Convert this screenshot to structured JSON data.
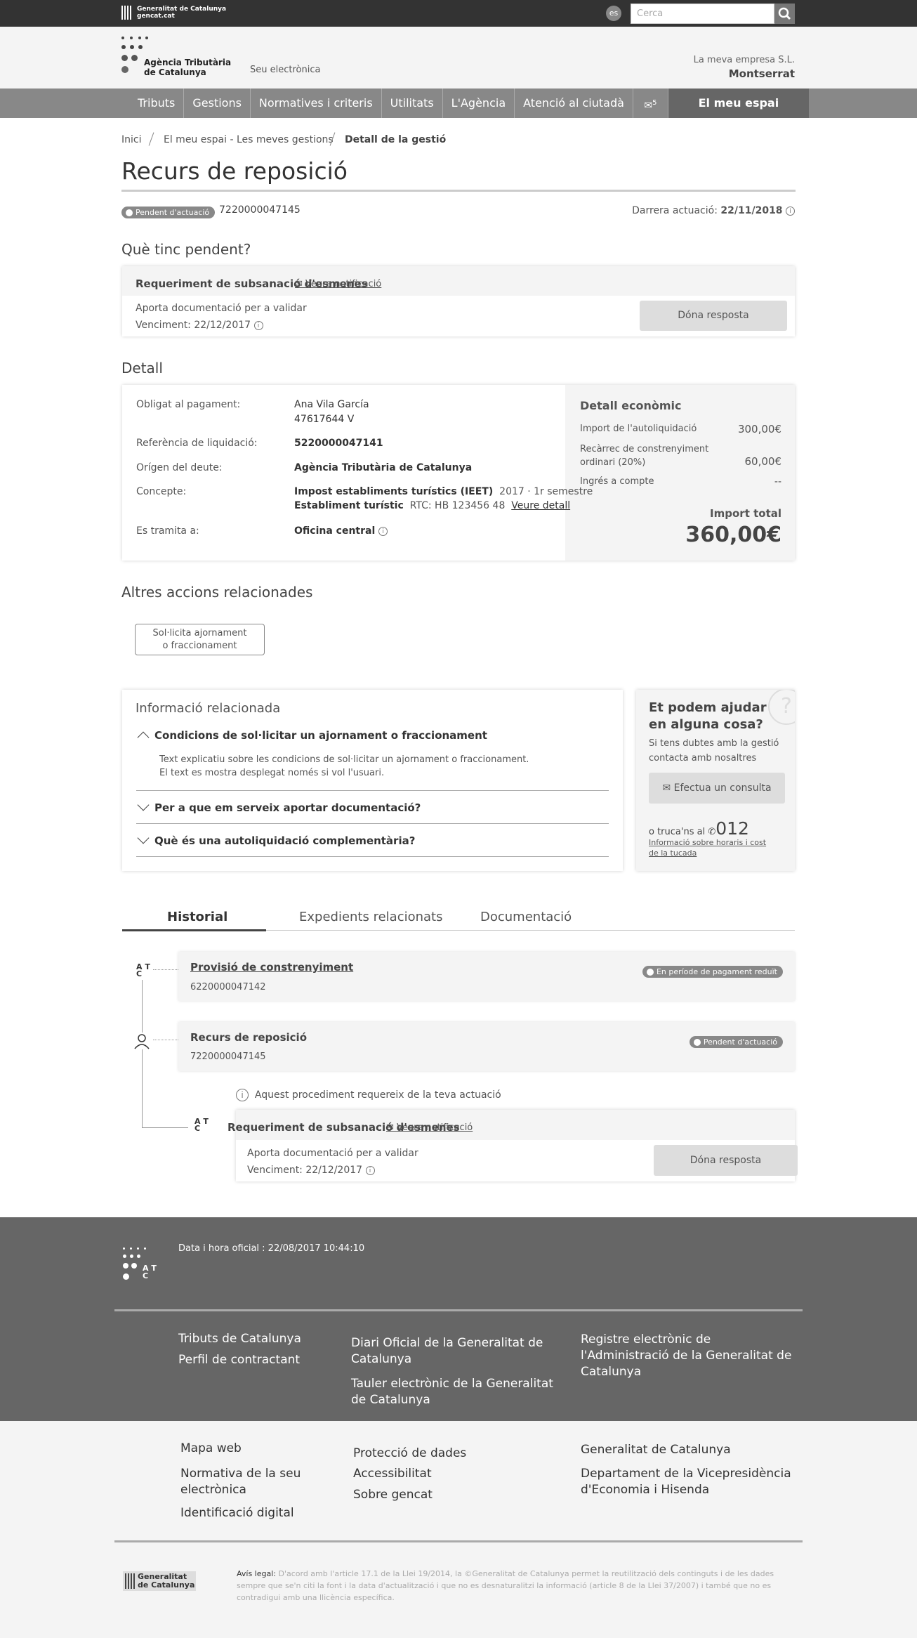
{
  "topbar": {
    "gencat_line1": "Generalitat de Catalunya",
    "gencat_line2": "gencat.cat",
    "lang": "es",
    "search_placeholder": "Cerca"
  },
  "header": {
    "agency_line1": "Agència Tributària",
    "agency_line2": "de Catalunya",
    "seu": "Seu electrònica",
    "company": "La meva empresa S.L.",
    "user": "Montserrat"
  },
  "nav": {
    "items": [
      "Tributs",
      "Gestions",
      "Normatives i criteris",
      "Utilitats",
      "L'Agència",
      "Atenció al ciutadà"
    ],
    "mail_count": "5",
    "espai": "El meu espai"
  },
  "breadcrumb": [
    "Inici",
    "El meu espai - Les meves gestions",
    "Detall de la gestió"
  ],
  "page": {
    "title": "Recurs de reposició",
    "status": "Pendent d'actuació",
    "ref": "7220000047145",
    "last_label": "Darrera actuació:",
    "last_date": "22/11/2018"
  },
  "pending": {
    "heading": "Què tinc pendent?",
    "card_title": "Requeriment de subsanació d'esmenes",
    "notif": "Veure notificació",
    "desc": "Aporta documentació per a validar",
    "due": "Venciment: 22/12/2017",
    "button": "Dóna resposta"
  },
  "detail": {
    "heading": "Detall",
    "rows": [
      {
        "label": "Obligat al pagament:",
        "value": "Ana Vila García",
        "value2": "47617644 V"
      },
      {
        "label": "Referència de liquidació:",
        "value": "5220000047141"
      },
      {
        "label": "Orígen del deute:",
        "value": "Agència Tributària de Catalunya"
      },
      {
        "label": "Concepte:",
        "value": "Impost establiments turístics (IEET)",
        "extra": "2017 · 1r semestre",
        "value2": "Establiment turístic",
        "extra2": "RTC: HB 123456 48",
        "link": "Veure detall"
      },
      {
        "label": "Es tramita a:",
        "value": "Oficina central"
      }
    ],
    "econ_title": "Detall econòmic",
    "econ": [
      {
        "label": "Import de l'autoliquidació",
        "value": "300,00€"
      },
      {
        "label": "Recàrrec de constrenyiment ordinari (20%)",
        "value": "60,00€"
      },
      {
        "label": "Ingrés a compte",
        "value": "--"
      }
    ],
    "total_label": "Import total",
    "total": "360,00€"
  },
  "actions": {
    "heading": "Altres accions relacionades",
    "button_l1": "Sol·licita ajornament",
    "button_l2": "o fraccionament"
  },
  "related": {
    "heading": "Informació relacionada",
    "acc": [
      {
        "title": "Condicions de sol·licitar un ajornament o fraccionament",
        "text1": "Text explicatiu sobre les condicions de sol·licitar un ajornament o fraccionament.",
        "text2": "El text es mostra desplegat només si vol l'usuari."
      },
      {
        "title": "Per a que em serveix aportar documentació?"
      },
      {
        "title": "Què és una autoliquidació complementària?"
      }
    ]
  },
  "help": {
    "title_l1": "Et podem ajudar",
    "title_l2": "en alguna cosa?",
    "text_l1": "Si tens dubtes amb la gestió",
    "text_l2": "contacta amb nosaltres",
    "button": "Efectua un consulta",
    "call": "o truca'ns al",
    "phone": "012",
    "link_l1": "Informació sobre horaris i cost",
    "link_l2": "de la tucada"
  },
  "tabs": [
    "Historial",
    "Expedients relacionats",
    "Documentació"
  ],
  "timeline": [
    {
      "title": "Provisió de constrenyiment",
      "ref": "6220000047142",
      "badge": "En període de pagament reduït"
    },
    {
      "title": "Recurs de reposició",
      "ref": "7220000047145",
      "badge": "Pendent d'actuació"
    }
  ],
  "timeline_notice": "Aquest procediment requereix de la teva actuació",
  "sub": {
    "title": "Requeriment de subsanació d'esmenes",
    "notif": "Veure notificació",
    "desc": "Aporta documentació per a validar",
    "due": "Venciment: 22/12/2017",
    "button": "Dóna resposta"
  },
  "footer": {
    "date": "Data i hora oficial : 22/08/2017 10:44:10",
    "col1": [
      "Tributs de Catalunya",
      "Perfil de contractant"
    ],
    "col2a": "Diari Oficial de la Generalitat de Catalunya",
    "col2b": "Tauler electrònic de la Generalitat de Catalunya",
    "col3": "Registre electrònic de l'Administració de la Generalitat de Catalunya",
    "b1": [
      "Mapa web",
      "Normativa de la seu electrònica",
      "Identificació digital"
    ],
    "b2": [
      "Protecció de dades",
      "Accessibilitat",
      "Sobre gencat"
    ],
    "b3": [
      "Generalitat de Catalunya",
      "Departament de la Vicepresidència d'Economia i Hisenda"
    ],
    "legal_label": "Avís legal:",
    "legal": "D'acord amb l'article 17.1 de la Llei 19/2014, la ©Generalitat de Catalunya permet la reutilització dels continguts i de les dades sempre que se'n citi la font i la data d'actualització i que no es desnaturalitzi la informació (article 8 de la Llei 37/2007) i també que no es contradigui amb una llicència específica.",
    "logo_l1": "Generalitat",
    "logo_l2": "de Catalunya"
  }
}
